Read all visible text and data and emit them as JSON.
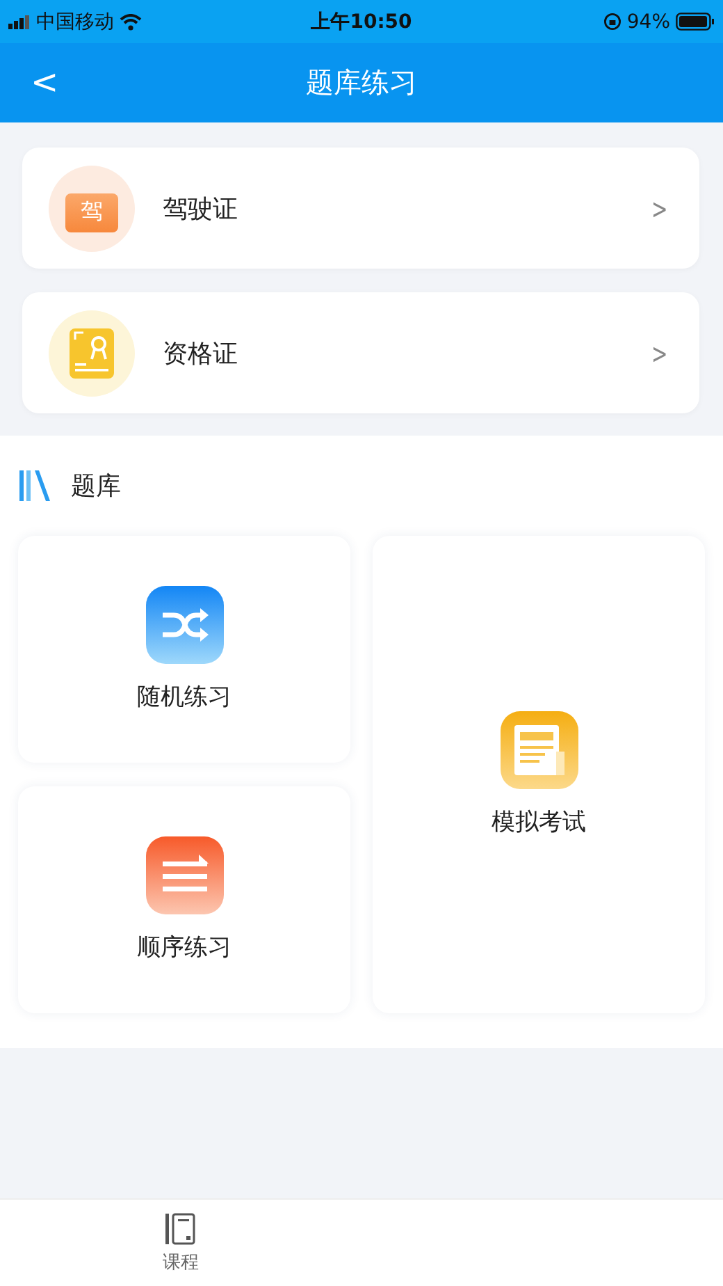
{
  "status_bar": {
    "carrier": "中国移动",
    "time": "上午10:50",
    "battery": "94%"
  },
  "nav": {
    "back": "<",
    "title": "题库练习"
  },
  "licenses": [
    {
      "kind": "driving",
      "name": "驾驶证",
      "icon_text": "驾",
      "chevron": ">"
    },
    {
      "kind": "certificate",
      "name": "资格证",
      "chevron": ">"
    }
  ],
  "bank": {
    "title": "题库",
    "modes": [
      {
        "kind": "random",
        "label": "随机练习"
      },
      {
        "kind": "sequence",
        "label": "顺序练习"
      },
      {
        "kind": "exam",
        "label": "模拟考试"
      }
    ]
  },
  "tab_bar": {
    "items": [
      {
        "label": "课程"
      }
    ]
  }
}
